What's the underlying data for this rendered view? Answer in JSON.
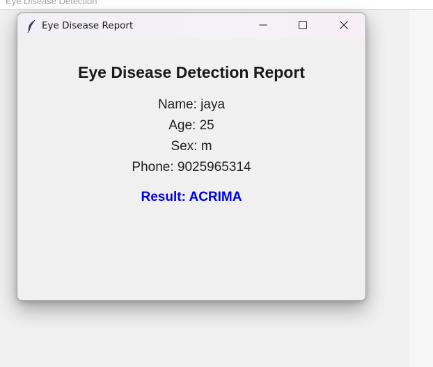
{
  "background_window": {
    "title": "Eye Disease Detection"
  },
  "dialog": {
    "title": "Eye Disease Report",
    "app_icon": "feather-icon",
    "controls": {
      "minimize_icon": "minimize-icon",
      "maximize_icon": "maximize-icon",
      "close_icon": "close-icon"
    }
  },
  "report": {
    "heading": "Eye Disease Detection Report",
    "name_line": "Name: jaya",
    "age_line": "Age: 25",
    "sex_line": "Sex: m",
    "phone_line": "Phone: 9025965314",
    "result_line": "Result: ACRIMA",
    "result_color": "#0000ee"
  }
}
